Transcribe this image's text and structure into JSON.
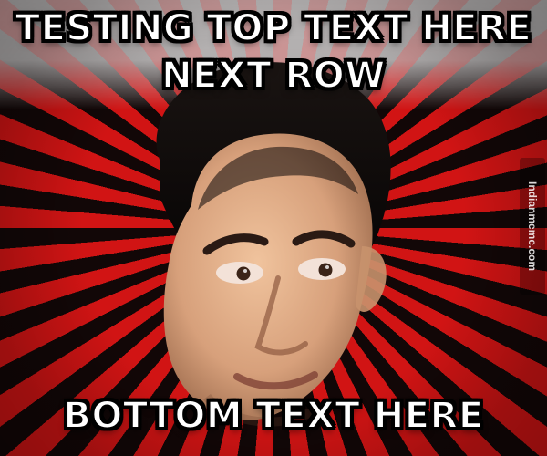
{
  "meme": {
    "top_text_line1": "TESTING TOP TEXT HERE",
    "top_text_line2": "NEXT ROW",
    "bottom_text": "BOTTOM TEXT HERE",
    "watermark": "Indianmeme.com"
  },
  "colors": {
    "burst_red": "#d11414",
    "burst_dark": "#120707",
    "burst_light": "#f2f2f2",
    "text": "#ffffff",
    "text_outline": "#000000"
  },
  "icons": {
    "face": "portrait-illustration"
  }
}
